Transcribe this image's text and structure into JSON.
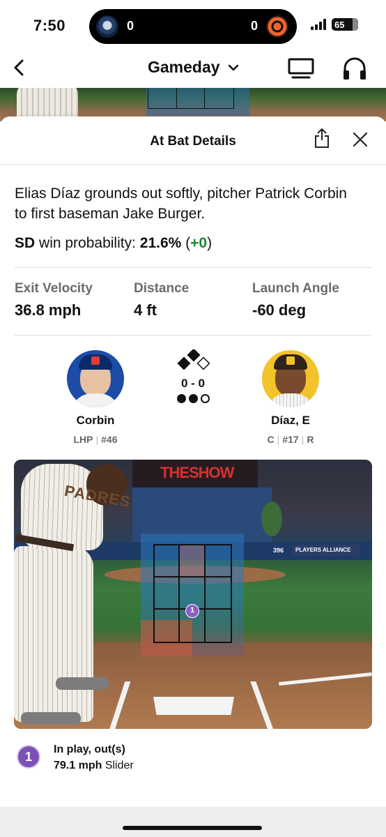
{
  "status_bar": {
    "time": "7:50",
    "away_score": "0",
    "home_score": "0",
    "battery": "65"
  },
  "header": {
    "title": "Gameday"
  },
  "sheet": {
    "title": "At Bat Details"
  },
  "play": {
    "description": "Elias Díaz grounds out softly, pitcher Patrick Corbin to first baseman Jake Burger.",
    "win_team": "SD",
    "win_label": "win probability:",
    "win_pct": "21.6%",
    "win_delta_open": "(",
    "win_delta": "+0",
    "win_delta_close": ")"
  },
  "stats": [
    {
      "label": "Exit Velocity",
      "value": "36.8 mph"
    },
    {
      "label": "Distance",
      "value": "4 ft"
    },
    {
      "label": "Launch Angle",
      "value": "-60 deg"
    }
  ],
  "pitcher": {
    "name": "Corbin",
    "hand": "LHP",
    "number": "#46"
  },
  "batter": {
    "name": "Díaz, E",
    "position": "C",
    "number": "#17",
    "bats": "R"
  },
  "situation": {
    "count": "0 - 0",
    "outs": 2,
    "bases": {
      "first": false,
      "second": true,
      "third": true
    }
  },
  "pitch_view": {
    "stadium_sign": "THESHOW",
    "wall_distance": "396",
    "ad_text": "PLAYERS ALLIANCE",
    "jersey_text": "PADRES"
  },
  "pitch_list": [
    {
      "number": "1",
      "result": "In play, out(s)",
      "speed": "79.1 mph",
      "type": "Slider"
    }
  ],
  "colors": {
    "accent_green": "#1a8a2e",
    "pitch_purple": "#7b51b8",
    "rangers_blue": "#1c4ca8",
    "padres_gold": "#f2c32b"
  }
}
